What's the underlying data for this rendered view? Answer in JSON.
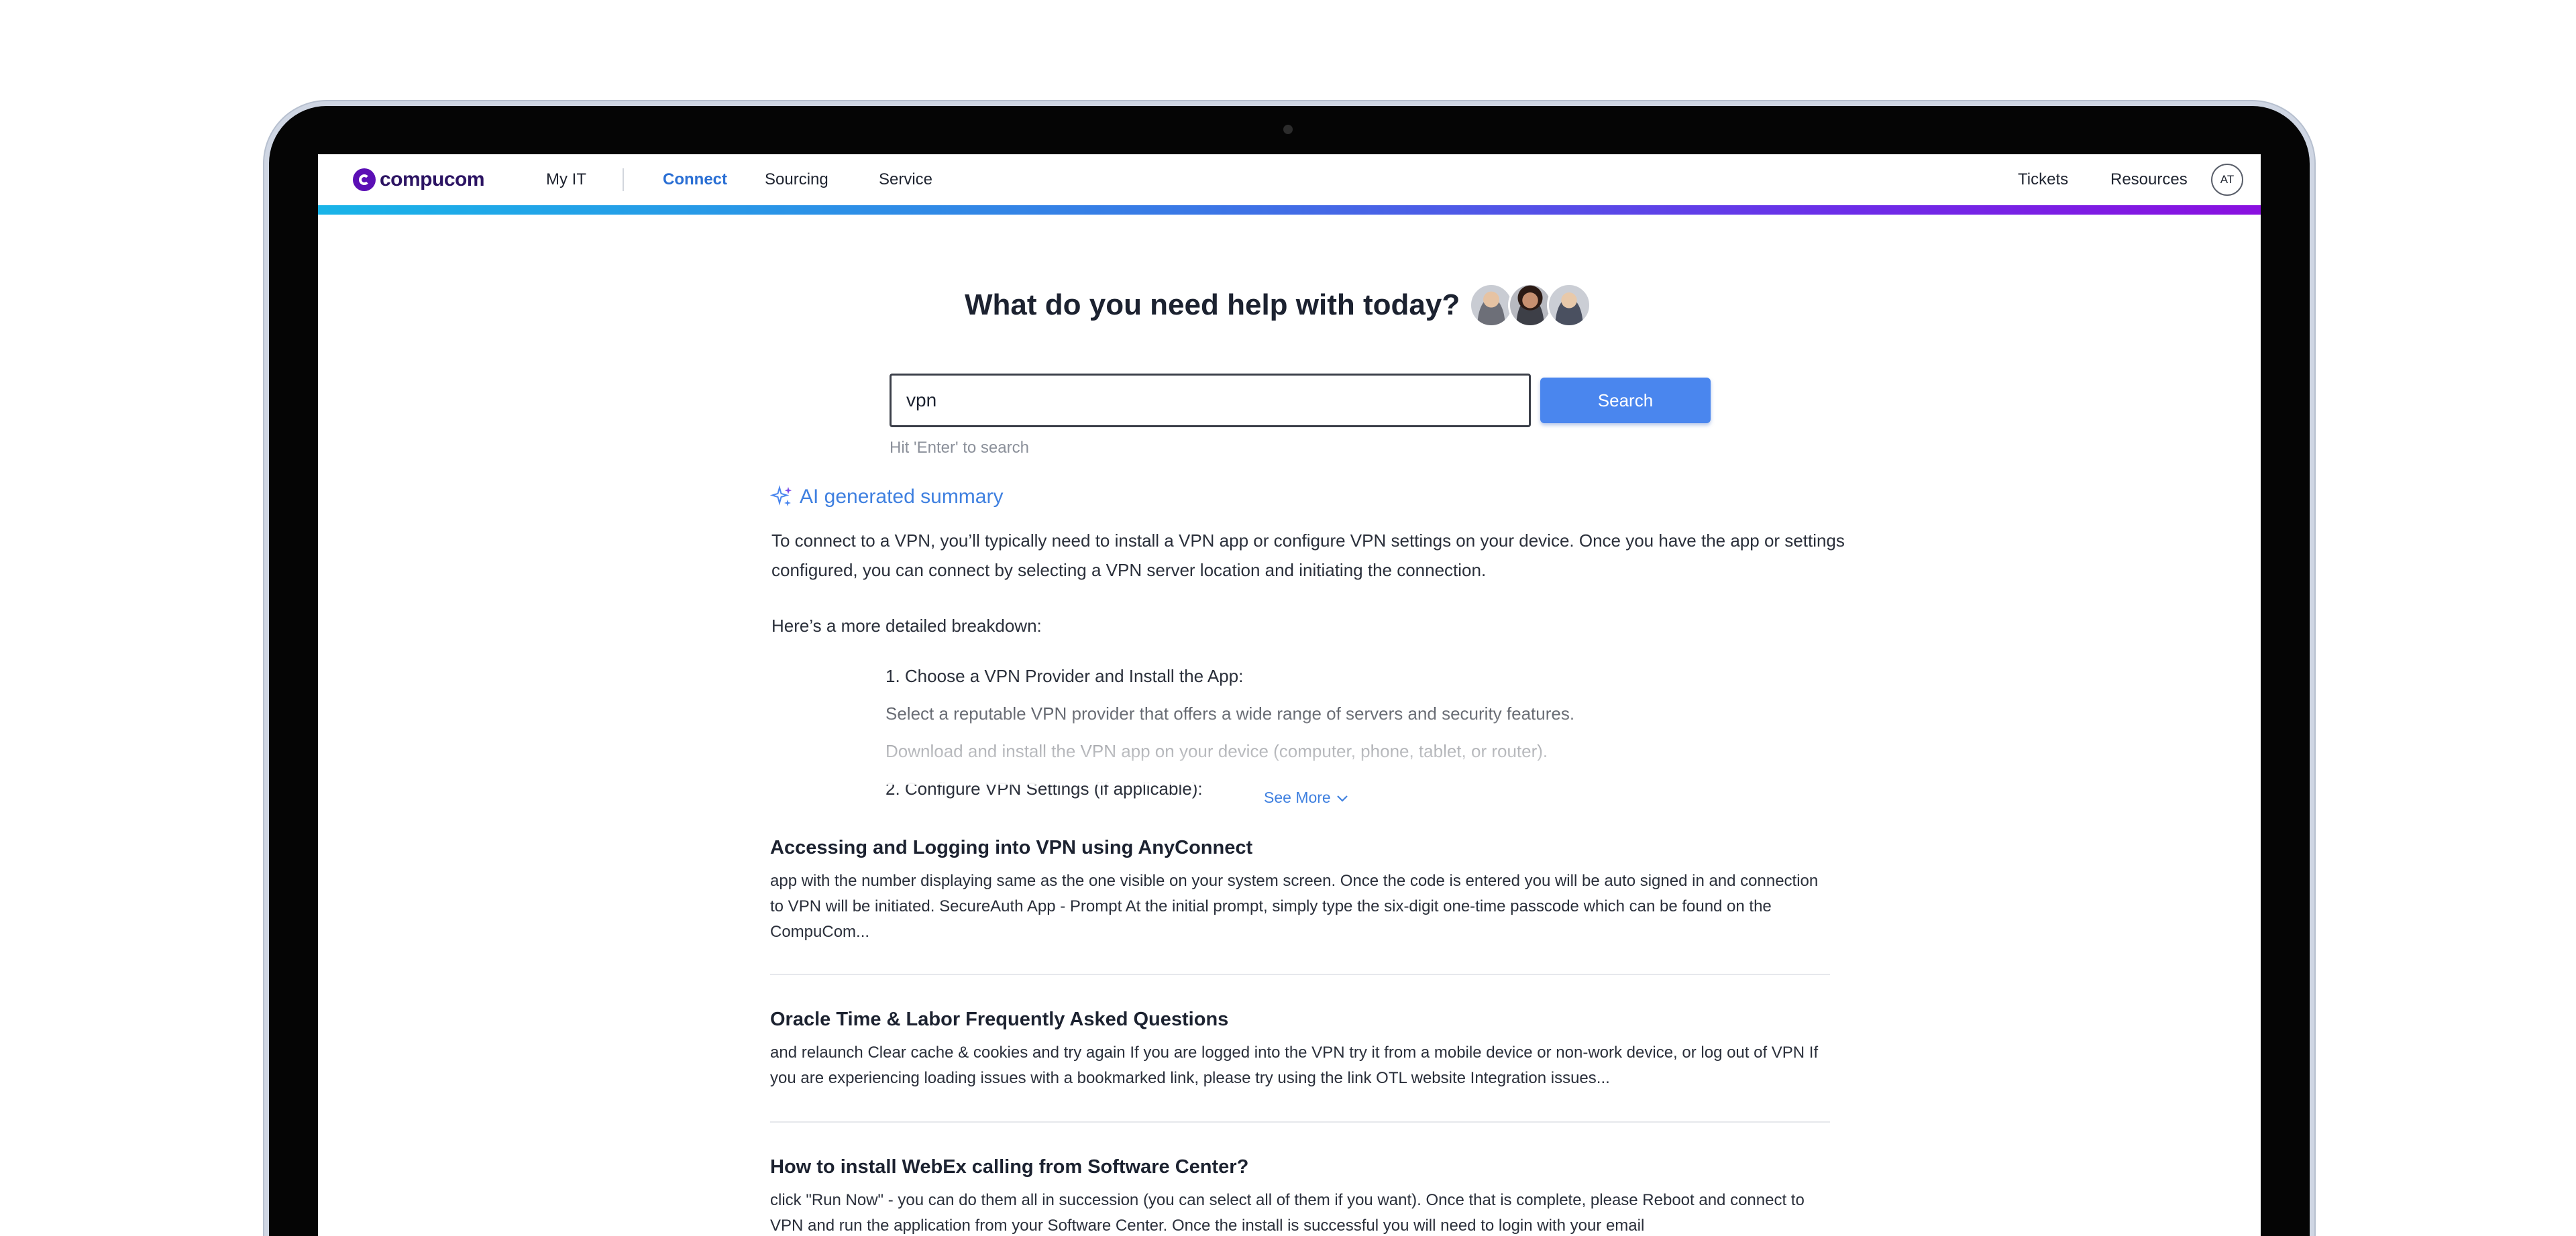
{
  "brand": {
    "name": "compucom"
  },
  "nav": {
    "left": [
      "My IT",
      "Connect",
      "Sourcing",
      "Service"
    ],
    "active": "Connect",
    "right": [
      "Tickets",
      "Resources"
    ],
    "user_initials": "AT"
  },
  "colors": {
    "brand": "#5b0fb5",
    "nav_active": "#2a6fd4",
    "accent_gradient": [
      "#19b4e8",
      "#3a78e6",
      "#6b2ee8",
      "#8a10e0"
    ],
    "search_button": "#4a86ee",
    "link": "#3f80e0"
  },
  "main": {
    "title": "What do you need help with today?",
    "agent_avatars": [
      "agent-avatar",
      "agent-avatar",
      "agent-avatar"
    ]
  },
  "search": {
    "value": "vpn",
    "button_label": "Search",
    "hint": "Hit 'Enter' to search"
  },
  "ai_summary": {
    "title": "AI generated summary",
    "paragraph": "To connect to a VPN, you’ll typically need to install a VPN app or configure VPN settings on your device. Once you have the app or settings configured, you can connect by selecting a VPN server location and initiating the connection.",
    "intro": "Here’s a more detailed breakdown:",
    "steps": [
      "1. Choose a VPN Provider and Install the App:",
      "Select a reputable VPN provider that offers a wide range of servers and security features.",
      "Download and install the VPN app on your device (computer, phone, tablet, or router).",
      "2. Configure VPN Settings (if applicable):"
    ],
    "see_more_label": "See More"
  },
  "results": [
    {
      "title": "Accessing and Logging into VPN using AnyConnect",
      "snippet": "app with the number displaying same as the one visible on your system screen. Once the code is entered you will be auto signed in and connection to VPN will be initiated. SecureAuth App - Prompt At the initial prompt, simply type the six-digit one-time passcode which can be found on the CompuCom..."
    },
    {
      "title": "Oracle Time & Labor Frequently Asked Questions",
      "snippet": "and relaunch Clear cache & cookies and try again If you are logged into the VPN try it from a mobile device or non-work device, or log out of VPN If you are experiencing loading issues with a bookmarked link, please try using the link OTL website Integration issues..."
    },
    {
      "title": "How to install WebEx calling from Software Center?",
      "snippet": "click \"Run Now\" - you can do them all in succession (you can select all of them if you want). Once that is complete, please Reboot and connect to VPN and run the application from your Software Center. Once the install is successful you will need to login with your email"
    }
  ]
}
